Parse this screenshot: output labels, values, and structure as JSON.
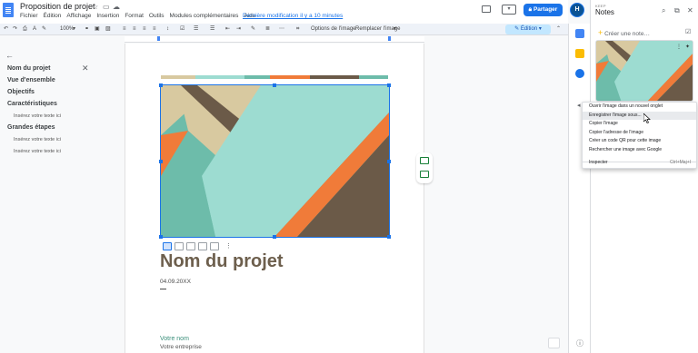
{
  "doc": {
    "title": "Proposition de projet",
    "menus": [
      "Fichier",
      "Édition",
      "Affichage",
      "Insertion",
      "Format",
      "Outils",
      "Modules complémentaires",
      "Aide"
    ],
    "last_edit": "Dernière modification il y a 10 minutes",
    "share_label": "Partager",
    "avatar_letter": "H"
  },
  "toolbar": {
    "zoom": "100%",
    "image_options": "Options de l'image",
    "replace_image": "Remplacer l'image",
    "mode": "Édition"
  },
  "outline": {
    "items": [
      {
        "label": "Nom du projet",
        "level": 1
      },
      {
        "label": "Vue d'ensemble",
        "level": 1
      },
      {
        "label": "Objectifs",
        "level": 1
      },
      {
        "label": "Caractéristiques",
        "level": 1
      },
      {
        "label": "Insérez votre texte ici",
        "level": 2
      },
      {
        "label": "Grandes étapes",
        "level": 1
      },
      {
        "label": "Insérez votre texte ici",
        "level": 2
      },
      {
        "label": "Insérez votre texte ici",
        "level": 2
      }
    ]
  },
  "page": {
    "project_title": "Nom du projet",
    "date": "04.09.20XX",
    "your_name": "Votre nom",
    "your_company": "Votre entreprise"
  },
  "keep": {
    "subtitle": "KEEP",
    "title": "Notes",
    "create_note": "Créer une note…"
  },
  "context_menu": {
    "items": [
      "Ouvrir l'image dans un nouvel onglet",
      "Enregistrer l'image sous...",
      "Copier l'image",
      "Copier l'adresse de l'image",
      "Créer un code QR pour cette image",
      "Rechercher une image avec Google"
    ],
    "highlighted_index": 1,
    "inspect": "Inspecter",
    "inspect_shortcut": "Ctrl+Maj+I"
  },
  "colors": {
    "accent": "#1a73e8",
    "teal": "#6dbcaa",
    "mint": "#9ddcd1",
    "beige": "#d8c9a0",
    "orange": "#f07b39",
    "brown": "#6b5a48"
  }
}
